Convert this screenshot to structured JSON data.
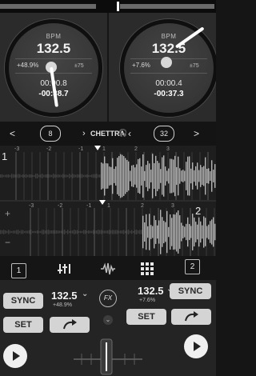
{
  "deck1": {
    "bpm_caption": "BPM",
    "bpm": "132.5",
    "pitch": "+48.9%",
    "range": "±75",
    "elapsed": "00:00.8",
    "remaining": "-00:38.7",
    "deck_number": "1",
    "sync_label": "SYNC",
    "set_label": "SET",
    "ctrl_bpm": "132.5",
    "ctrl_pitch": "+48.9%",
    "tab_number": "1"
  },
  "deck2": {
    "bpm_caption": "BPM",
    "bpm": "132.5",
    "pitch": "+7.6%",
    "range": "±75",
    "elapsed": "00:00.4",
    "remaining": "-00:37.3",
    "deck_number": "2",
    "sync_label": "SYNC",
    "set_label": "SET",
    "ctrl_bpm": "132.5",
    "ctrl_pitch": "+7.6%",
    "tab_number": "2"
  },
  "nav": {
    "left_arrow": "<",
    "loop1": "8",
    "track_title": "CHETTRA",
    "loop2": "32",
    "right_arrow": ">"
  },
  "waveform": {
    "deck1_beats": [
      "-3",
      "-2",
      "-1",
      "1",
      "2",
      "3"
    ],
    "deck2_beats": [
      "-3",
      "-2",
      "-1",
      "1",
      "2",
      "3"
    ],
    "deck1_side_label": "1",
    "deck2_side_label": "2",
    "plus": "+",
    "minus": "−"
  },
  "controls": {
    "fx_label": "FX"
  },
  "colors": {
    "background": "#151515",
    "panel": "#2b2b2b",
    "button": "#d4d4d4",
    "text": "#e6e6e6"
  }
}
